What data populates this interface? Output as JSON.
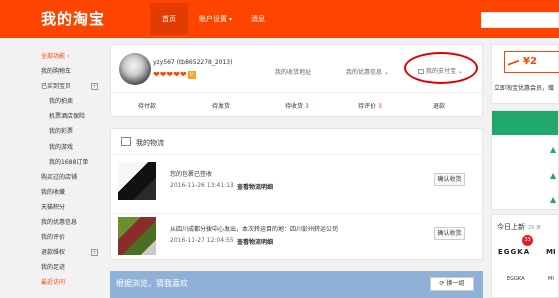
{
  "header": {
    "brand": "我的淘宝",
    "nav": {
      "home": "首页",
      "account_settings": "账户设置",
      "messages": "消息"
    }
  },
  "sidebar": {
    "items": [
      {
        "label": "全部功能",
        "color": "#ff4400"
      },
      {
        "label": "我的购物车"
      },
      {
        "label": "已买到宝贝",
        "expand": "+"
      },
      {
        "label": "我的拍卖"
      },
      {
        "label": "机票酒店保险"
      },
      {
        "label": "我的彩票"
      },
      {
        "label": "我的游戏"
      },
      {
        "label": "我的1688订单"
      },
      {
        "label": "购买过的店铺"
      },
      {
        "label": "我的收藏"
      },
      {
        "label": "天猫积分"
      },
      {
        "label": "我的优惠信息"
      },
      {
        "label": "我的评价"
      },
      {
        "label": "退款维权",
        "expand": "+"
      },
      {
        "label": "我的足迹"
      },
      {
        "label": "最近访问",
        "color": "#ff4400"
      }
    ]
  },
  "profile": {
    "username": "yzy567 (tb8652278_2013)",
    "vip_badge": "V",
    "hearts": "❤❤❤❤❤",
    "links": {
      "address": "我的收货地址",
      "benefits": "我的优惠信息",
      "alipay": "我的支付宝"
    },
    "orders": [
      {
        "label": "待付款",
        "count": ""
      },
      {
        "label": "待发货",
        "count": ""
      },
      {
        "label": "待收货",
        "count": "3"
      },
      {
        "label": "待评价",
        "count": "3"
      },
      {
        "label": "退款",
        "count": ""
      }
    ]
  },
  "logistics": {
    "title": "我的物流",
    "items": [
      {
        "desc": "您的包裹已签收",
        "time": "2016-11-26 13:41:13",
        "detail": "查看物流明细",
        "action": "确认收货"
      },
      {
        "desc": "从四川成都分拨中心发出，本次转运目的地：四川彭州转运公司",
        "time": "2016-11-27 12:04:55",
        "detail": "查看物流明细",
        "action": "确认收货"
      }
    ]
  },
  "recommend": {
    "title": "根据浏览，猜我喜欢",
    "refresh": "换一组"
  },
  "right_panel": {
    "coupon": "¥2",
    "promo": "立即淘宝优惠会员，赠",
    "today_title": "今日上新",
    "today_count": "29 家",
    "badge": "33",
    "brand_1": "EGGKA",
    "brand_2": "MI",
    "brand_1_sub": "EGGKA",
    "brand_2_sub": "MI"
  },
  "colors": {
    "brand_orange": "#ff4400",
    "annotation_red": "#e50000",
    "panel_green": "#21a86b"
  }
}
